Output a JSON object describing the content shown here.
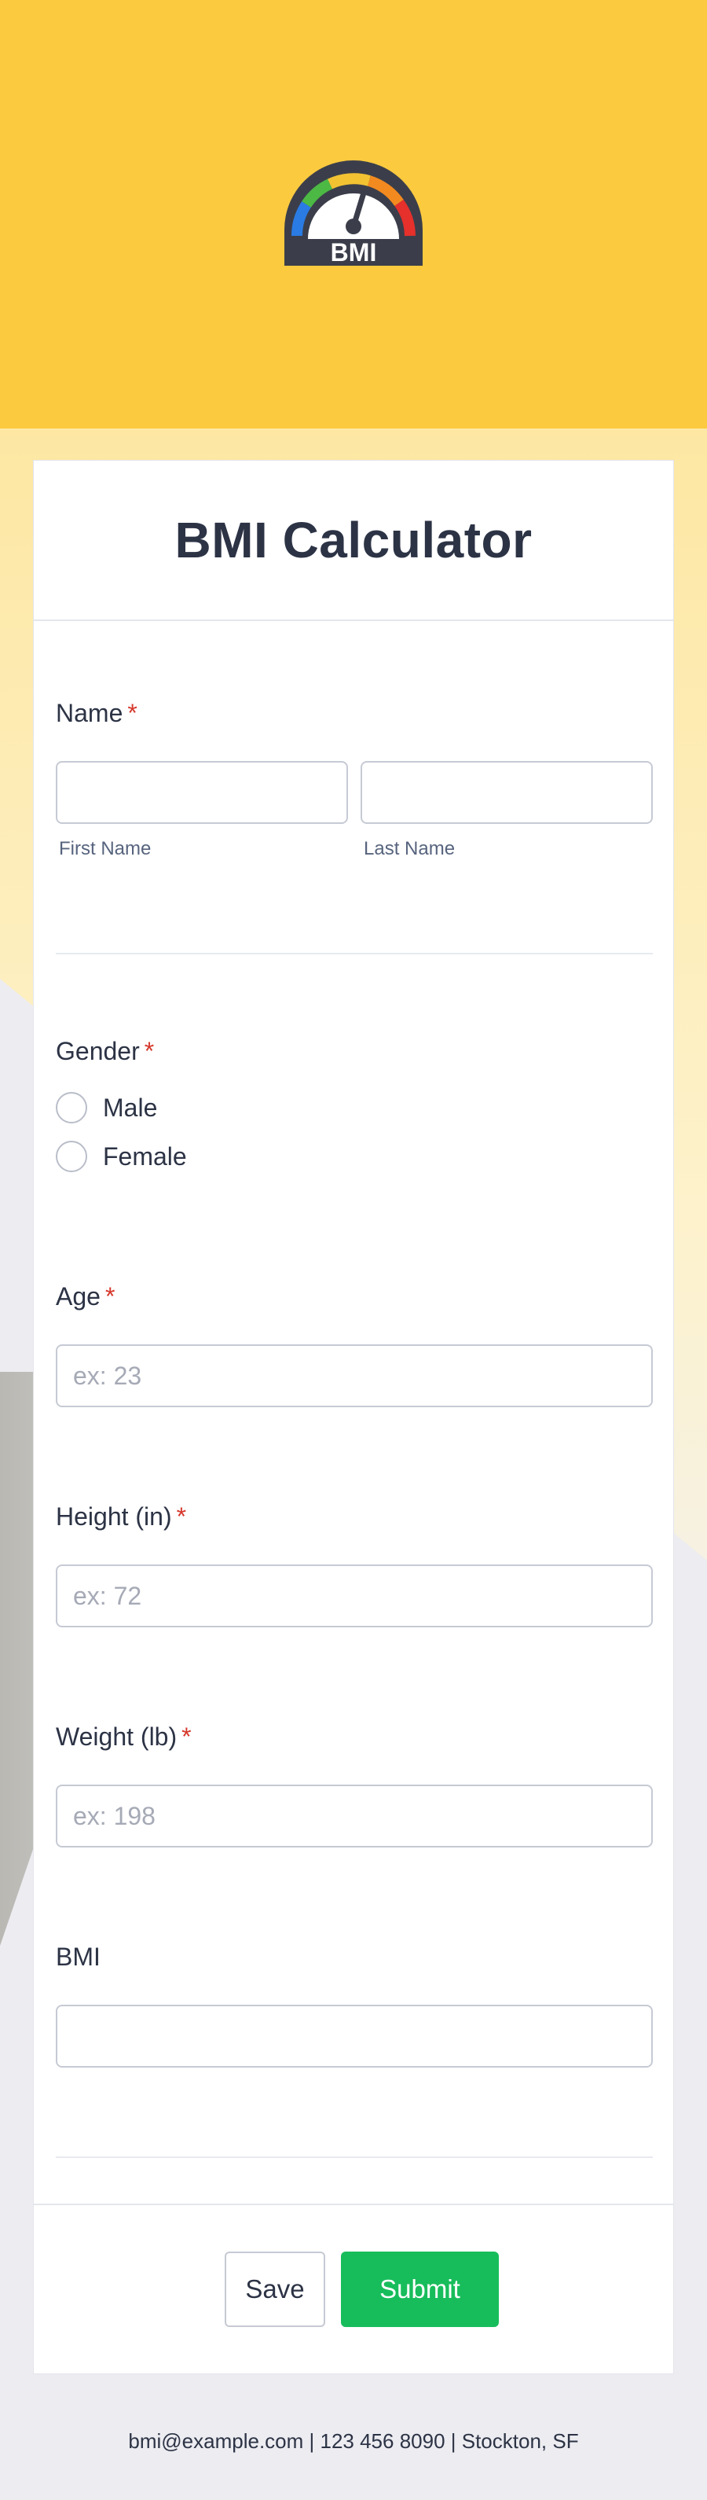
{
  "logo": {
    "text": "BMI",
    "icon": "gauge-icon"
  },
  "form": {
    "title": "BMI Calculator",
    "required_mark": "*",
    "name": {
      "label": "Name",
      "first_placeholder": "",
      "last_placeholder": "",
      "first_sublabel": "First Name",
      "last_sublabel": "Last Name"
    },
    "gender": {
      "label": "Gender",
      "options": [
        "Male",
        "Female"
      ]
    },
    "age": {
      "label": "Age",
      "placeholder": "ex: 23"
    },
    "height": {
      "label": "Height (in)",
      "placeholder": "ex: 72"
    },
    "weight": {
      "label": "Weight (lb)",
      "placeholder": "ex: 198"
    },
    "bmi": {
      "label": "BMI",
      "placeholder": ""
    },
    "buttons": {
      "save": "Save",
      "submit": "Submit"
    }
  },
  "footer": {
    "text": "bmi@example.com | 123 456 8090 | Stockton, SF"
  },
  "colors": {
    "header": "#fcca3f",
    "submit": "#18bd5b",
    "required": "#d6382c"
  }
}
